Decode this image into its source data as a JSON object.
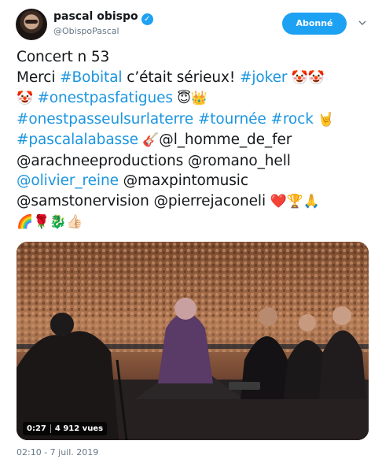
{
  "author": {
    "name": "pascal obispo",
    "handle": "@ObispoPascal",
    "verified_glyph": "✓"
  },
  "follow_button": {
    "label": "Abonné"
  },
  "tweet": {
    "lines": [
      [
        {
          "t": "Concert n 53",
          "k": "text"
        }
      ],
      [
        {
          "t": "Merci ",
          "k": "text"
        },
        {
          "t": "#Bobital",
          "k": "tag"
        },
        {
          "t": " c’était sérieux! ",
          "k": "text"
        },
        {
          "t": "#joker",
          "k": "tag"
        },
        {
          "t": " 🤡🤡",
          "k": "emoji"
        }
      ],
      [
        {
          "t": "🤡 ",
          "k": "emoji"
        },
        {
          "t": "#onestpasfatigues",
          "k": "tag"
        },
        {
          "t": " 😇👑",
          "k": "emoji"
        }
      ],
      [
        {
          "t": "#onestpasseulsurlaterre",
          "k": "tag"
        },
        {
          "t": " ",
          "k": "text"
        },
        {
          "t": "#tournée",
          "k": "tag"
        },
        {
          "t": " ",
          "k": "text"
        },
        {
          "t": "#rock",
          "k": "tag"
        },
        {
          "t": " 🤘",
          "k": "emoji"
        }
      ],
      [
        {
          "t": "#pascalalabasse",
          "k": "tag"
        },
        {
          "t": "  🎸",
          "k": "emoji"
        },
        {
          "t": "@l_homme_de_fer",
          "k": "text"
        }
      ],
      [
        {
          "t": "@arachneeproductions @romano_hell",
          "k": "text"
        }
      ],
      [
        {
          "t": "@olivier_reine",
          "k": "tag"
        },
        {
          "t": " @maxpintomusic",
          "k": "text"
        }
      ],
      [
        {
          "t": "@samstonervision @pierrejaconeli ",
          "k": "text"
        },
        {
          "t": "❤️🏆🙏",
          "k": "emoji"
        }
      ],
      [
        {
          "t": "🌈🌹🐉👍🏻",
          "k": "emoji"
        }
      ]
    ]
  },
  "media": {
    "duration": "0:27",
    "views": "4 912 vues"
  },
  "timestamp": "02:10 - 7 juil. 2019",
  "colors": {
    "accent": "#1da1f2",
    "link": "#1b95e0",
    "muted": "#657786"
  },
  "icons": {
    "verified": "verified-badge-icon",
    "caret": "chevron-down-icon"
  }
}
